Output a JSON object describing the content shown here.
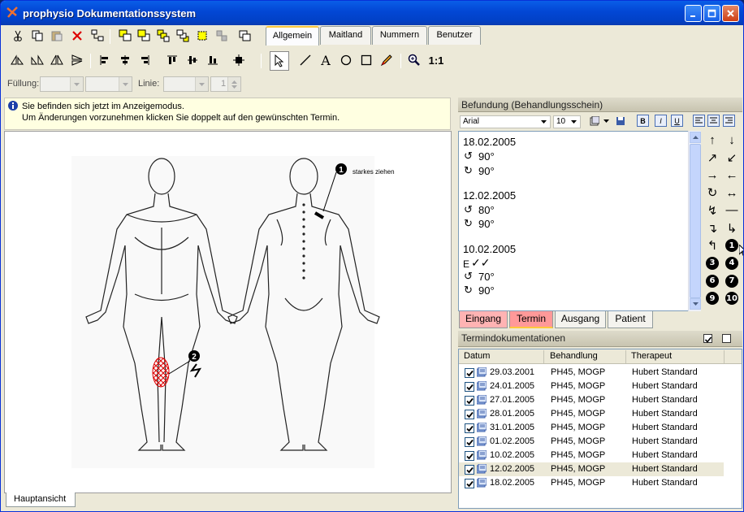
{
  "window": {
    "title": "prophysio Dokumentationssystem"
  },
  "top_tabs": [
    {
      "label": "Allgemein",
      "active": true
    },
    {
      "label": "Maitland",
      "active": false
    },
    {
      "label": "Nummern",
      "active": false
    },
    {
      "label": "Benutzer",
      "active": false
    }
  ],
  "format_bar": {
    "fill_label": "Füllung:",
    "line_label": "Linie:",
    "line_width": "1"
  },
  "info": {
    "line1": "Sie befinden sich jetzt im Anzeigemodus.",
    "line2": "Um Änderungen vorzunehmen klicken Sie doppelt auf den gewünschten Termin."
  },
  "drawing": {
    "annotation1": "starkes ziehen",
    "marker1": "1",
    "marker2": "2"
  },
  "bottom_tab": {
    "label": "Hauptansicht"
  },
  "befund": {
    "header": "Befundung (Behandlungsschein)",
    "font": "Arial",
    "size": "10",
    "entries": [
      {
        "date": "18.02.2005",
        "values": [
          "90°",
          "90°"
        ],
        "extra": ""
      },
      {
        "date": "12.02.2005",
        "values": [
          "80°",
          "90°"
        ],
        "extra": ""
      },
      {
        "date": "10.02.2005",
        "values": [
          "70°",
          "90°"
        ],
        "extra": "E"
      }
    ]
  },
  "symbols": [
    "↑",
    "↓",
    "↗",
    "↙",
    "→",
    "←",
    "↻",
    "↔",
    "↯",
    "—",
    "↴",
    "↳",
    "↰",
    "1",
    "3",
    "4",
    "6",
    "7",
    "9",
    "10"
  ],
  "right_tabs": [
    {
      "label": "Eingang",
      "active": false
    },
    {
      "label": "Termin",
      "active": true
    },
    {
      "label": "Ausgang",
      "active": false
    },
    {
      "label": "Patient",
      "active": false
    }
  ],
  "termine": {
    "header": "Termindokumentationen",
    "columns": [
      "Datum",
      "Behandlung",
      "Therapeut"
    ],
    "rows": [
      {
        "date": "29.03.2001",
        "treatment": "PH45, MOGP",
        "therapist": "Hubert Standard",
        "checked": true
      },
      {
        "date": "24.01.2005",
        "treatment": "PH45, MOGP",
        "therapist": "Hubert Standard",
        "checked": true
      },
      {
        "date": "27.01.2005",
        "treatment": "PH45, MOGP",
        "therapist": "Hubert Standard",
        "checked": true
      },
      {
        "date": "28.01.2005",
        "treatment": "PH45, MOGP",
        "therapist": "Hubert Standard",
        "checked": true
      },
      {
        "date": "31.01.2005",
        "treatment": "PH45, MOGP",
        "therapist": "Hubert Standard",
        "checked": true
      },
      {
        "date": "01.02.2005",
        "treatment": "PH45, MOGP",
        "therapist": "Hubert Standard",
        "checked": true
      },
      {
        "date": "10.02.2005",
        "treatment": "PH45, MOGP",
        "therapist": "Hubert Standard",
        "checked": true
      },
      {
        "date": "12.02.2005",
        "treatment": "PH45, MOGP",
        "therapist": "Hubert Standard",
        "checked": true,
        "selected": true
      },
      {
        "date": "18.02.2005",
        "treatment": "PH45, MOGP",
        "therapist": "Hubert Standard",
        "checked": true
      }
    ]
  }
}
